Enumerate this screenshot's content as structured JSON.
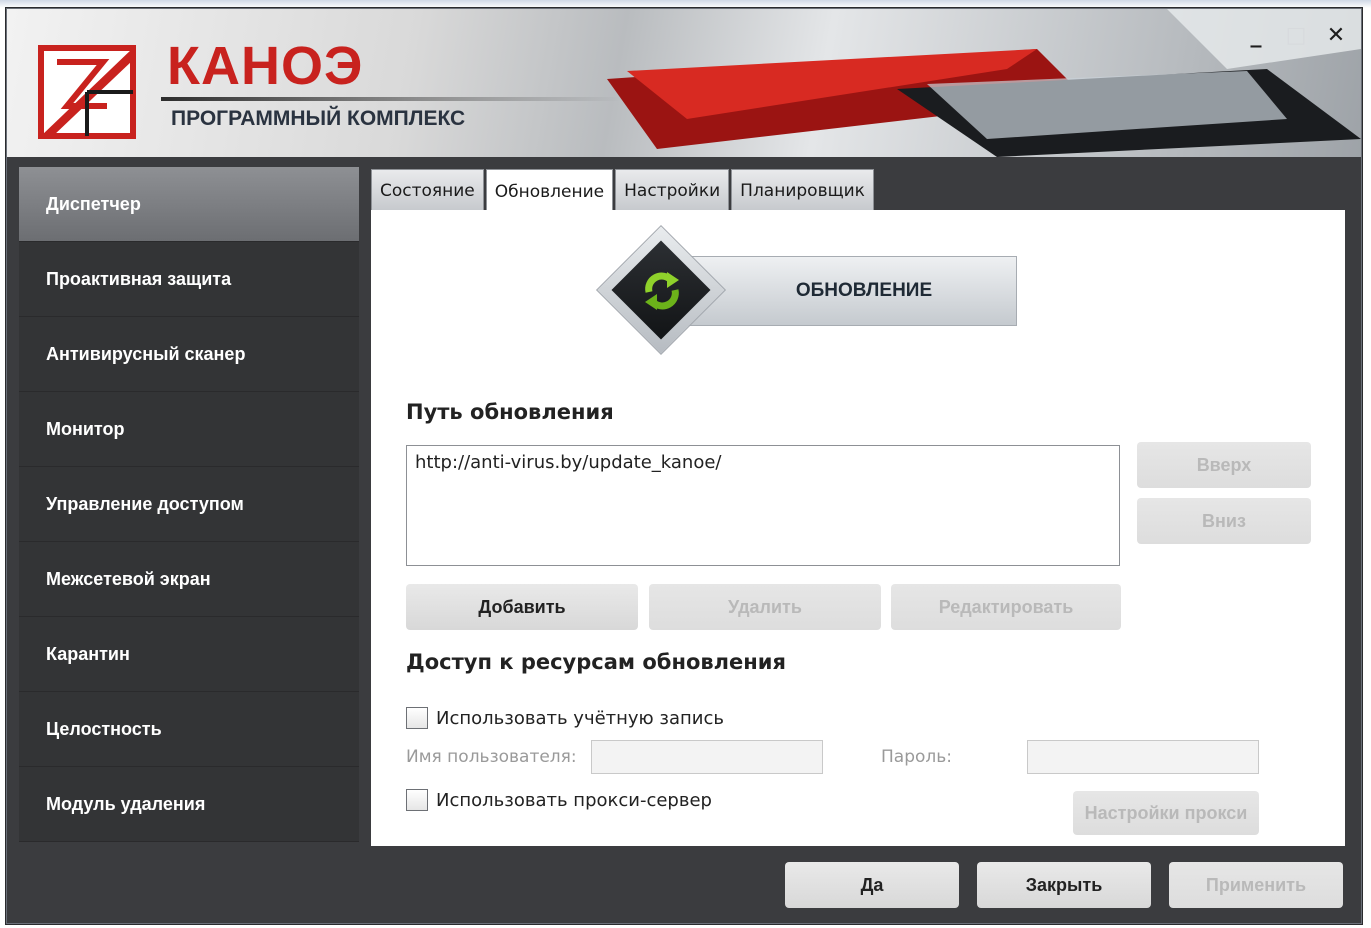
{
  "window": {
    "brand": "КАНОЭ",
    "subtitle": "ПРОГРАММНЫЙ КОМПЛЕКС",
    "controls": {
      "minimize": "_",
      "maximize": "□",
      "close": "✕"
    }
  },
  "sidebar": {
    "items": [
      {
        "label": "Диспетчер",
        "active": true
      },
      {
        "label": "Проактивная защита"
      },
      {
        "label": "Антивирусный сканер"
      },
      {
        "label": "Монитор"
      },
      {
        "label": "Управление доступом"
      },
      {
        "label": "Межсетевой экран"
      },
      {
        "label": "Карантин"
      },
      {
        "label": "Целостность"
      },
      {
        "label": "Модуль удаления"
      }
    ]
  },
  "tabs": [
    {
      "label": "Состояние"
    },
    {
      "label": "Обновление",
      "active": true
    },
    {
      "label": "Настройки"
    },
    {
      "label": "Планировщик"
    }
  ],
  "update": {
    "button_label": "ОБНОВЛЕНИЕ",
    "icon": "refresh-icon"
  },
  "path_section": {
    "title": "Путь обновления",
    "items": [
      "http://anti-virus.by/update_kanoe/"
    ],
    "up_label": "Вверх",
    "down_label": "Вниз",
    "add_label": "Добавить",
    "delete_label": "Удалить",
    "edit_label": "Редактировать"
  },
  "access_section": {
    "title": "Доступ к ресурсам обновления",
    "use_account_label": "Использовать учётную запись",
    "username_label": "Имя пользователя:",
    "username_value": "",
    "password_label": "Пароль:",
    "password_value": "",
    "use_proxy_label": "Использовать прокси-сервер",
    "proxy_settings_label": "Настройки прокси"
  },
  "footer": {
    "ok_label": "Да",
    "close_label": "Закрыть",
    "apply_label": "Применить"
  },
  "colors": {
    "brand_red": "#c8221e",
    "sidebar_bg": "#333436",
    "window_bg": "#3b3c3f",
    "icon_green": "#8fd12b"
  }
}
